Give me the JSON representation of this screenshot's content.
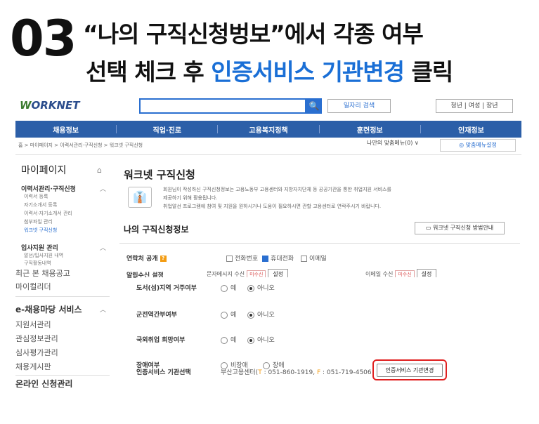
{
  "header": {
    "step": "03",
    "line1": "“나의 구직신청벙보”에서 각종 여부",
    "line2_prefix": "선택 체크 후 ",
    "line2_blue": "인증서비스 기관변경",
    "line2_suffix": "  클릭"
  },
  "site": {
    "logo_w": "W",
    "logo_rest": "ORKNET",
    "search_icon": "🔍",
    "job_search": "일자리 검색",
    "top_links": "청년 | 여성 | 장년",
    "nav": [
      "채용정보",
      "직업·진로",
      "고용복지정책",
      "훈련정보",
      "인재정보"
    ],
    "breadcrumb": "홈 > 마이페이지 > 이력서관리·구직신청 > 워크넷 구직신청",
    "my_menu": "나만의 맞춤메뉴(0) ∨",
    "menu_setting": "◎ 맞춤메뉴설정"
  },
  "sidebar": {
    "title": "마이페이지",
    "home_icon": "⌂",
    "group1": "이력서관리·구직신청",
    "group1_items": [
      "이력서 등록",
      "자기소개서 등록",
      "이력서·자기소개서 관리",
      "첨부파일 관리",
      "워크넷 구직신청"
    ],
    "group2": "입사지원 관리",
    "group2_items": [
      "알선/입사지원 내역",
      "구직활동내역"
    ],
    "recent": "최근 본 채용공고",
    "recent_overlap": "마이컬리더",
    "section2": "e-채용마당 서비스",
    "section2_items": [
      "지원서관리",
      "관심정보관리",
      "심사평가관리",
      "채용게시판"
    ],
    "section3": "온라인 신청관리"
  },
  "main": {
    "title": "워크넷 구직신청",
    "notice_icon": "👔",
    "notice_line1": "회원님이 작성하신 구직신청정보는 고용노동부 고용센터와 지방자치단체 등 공공기관을 통한 취업지원 서비스를",
    "notice_line2": "제공하기 위해 활용됩니다.",
    "notice_line3": "취업알선 프로그램에 참여 및 지원을 원하시거나 도움이 필요하시면 관할 고용센터로 연락주시기 바랍니다.",
    "section": "나의 구직신청정보",
    "guide_button": "▭ 워크넷 구직신청 방법안내"
  },
  "form": {
    "contact_label": "연락처 공개",
    "contact_badge": "?",
    "contact_options": [
      {
        "label": "전화번호",
        "checked": false
      },
      {
        "label": "휴대전화",
        "checked": true
      },
      {
        "label": "이메일",
        "checked": false
      }
    ],
    "receive_label": "알림수신 설정",
    "receive_sms": "문자메시지 수신",
    "receive_email": "이메일 수신",
    "receive_tag": "미수신",
    "receive_button": "설정",
    "rows": [
      {
        "label": "도서(섬)지역 거주여부",
        "opt1": "예",
        "opt2": "아니오"
      },
      {
        "label": "군전역간부여부",
        "opt1": "예",
        "opt2": "아니오"
      },
      {
        "label": "국외취업 희망여부",
        "opt1": "예",
        "opt2": "아니오"
      },
      {
        "label": "장애여부",
        "opt1": "비장애",
        "opt2": "장애"
      }
    ],
    "agency_label": "인증서비스 기관선택",
    "agency_name": "부산고용센터(",
    "agency_t": "T",
    "agency_tel": " : 051-860-1919, ",
    "agency_f": "F",
    "agency_fax": " : 051-719-4506",
    "change_button": "인증서비스 기관변경"
  }
}
